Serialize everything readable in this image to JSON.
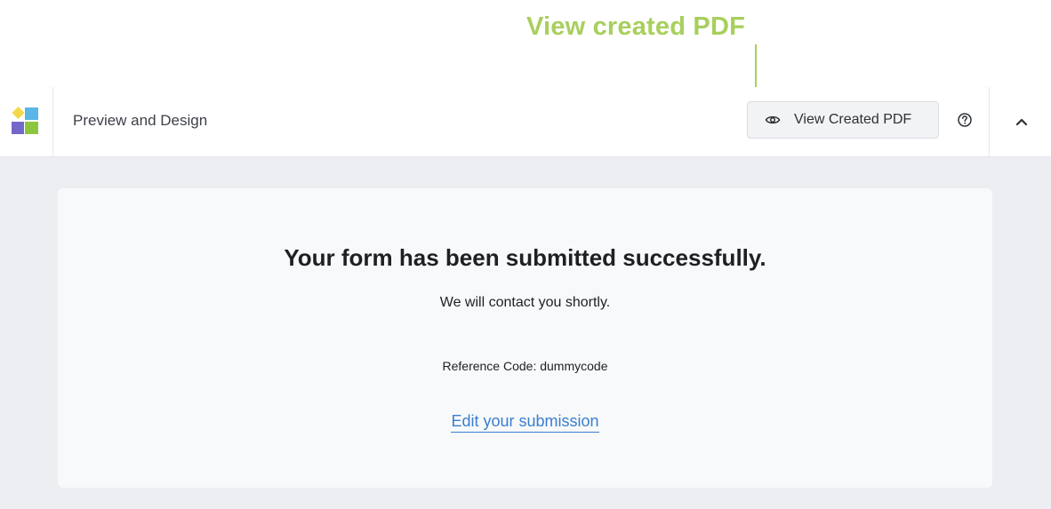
{
  "annotation": {
    "label": "View created PDF",
    "color": "#a8cf5c"
  },
  "toolbar": {
    "logo_icon": "app-logo-icon",
    "title": "Preview and Design",
    "view_pdf_button": {
      "label": "View Created PDF",
      "icon": "eye-icon"
    },
    "help_icon": "help-circle-icon",
    "collapse_icon": "chevron-up-icon"
  },
  "card": {
    "headline": "Your form has been submitted successfully.",
    "subline": "We will contact you shortly.",
    "reference": "Reference Code: dummycode",
    "edit_link": "Edit your submission",
    "link_color": "#3a7fcf"
  }
}
